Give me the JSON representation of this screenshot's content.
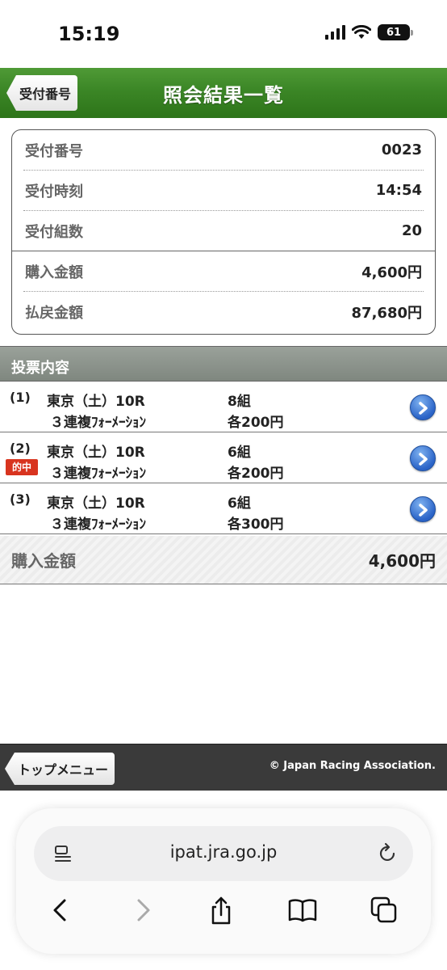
{
  "status": {
    "time": "15:19",
    "battery": "61"
  },
  "header": {
    "back_label": "受付番号",
    "title": "照会結果一覧"
  },
  "summary": [
    {
      "label": "受付番号",
      "value": "0023"
    },
    {
      "label": "受付時刻",
      "value": "14:54"
    },
    {
      "label": "受付組数",
      "value": "20"
    },
    {
      "label": "購入金額",
      "value": "4,600円"
    },
    {
      "label": "払戻金額",
      "value": "87,680円"
    }
  ],
  "section": {
    "title": "投票内容"
  },
  "bets": [
    {
      "no": "(1)",
      "race": "東京（土）10R",
      "type": "３連複ﾌｫｰﾒｰｼｮﾝ",
      "combos": "8組",
      "each": "各200円",
      "hit": ""
    },
    {
      "no": "(2)",
      "race": "東京（土）10R",
      "type": "３連複ﾌｫｰﾒｰｼｮﾝ",
      "combos": "6組",
      "each": "各200円",
      "hit": "的中"
    },
    {
      "no": "(3)",
      "race": "東京（土）10R",
      "type": "３連複ﾌｫｰﾒｰｼｮﾝ",
      "combos": "6組",
      "each": "各300円",
      "hit": ""
    }
  ],
  "total": {
    "label": "購入金額",
    "value": "4,600円"
  },
  "footer": {
    "top_label": "トップメニュー",
    "copyright": "© Japan Racing Association."
  },
  "browser": {
    "url": "ipat.jra.go.jp"
  },
  "colors": {
    "header_green": "#3b8626",
    "hit_red": "#d8341f",
    "arrow_blue": "#2a63c7"
  }
}
